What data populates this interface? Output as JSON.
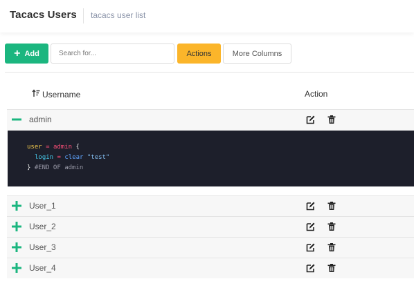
{
  "header": {
    "title": "Tacacs Users",
    "subtitle": "tacacs user list"
  },
  "toolbar": {
    "add_label": "Add",
    "search_placeholder": "Search for...",
    "actions_label": "Actions",
    "more_columns_label": "More Columns"
  },
  "table": {
    "columns": [
      "Username",
      "Action"
    ],
    "rows": [
      {
        "username": "admin",
        "expanded": true
      },
      {
        "username": "User_1",
        "expanded": false
      },
      {
        "username": "User_2",
        "expanded": false
      },
      {
        "username": "User_3",
        "expanded": false
      },
      {
        "username": "User_4",
        "expanded": false
      }
    ]
  },
  "code_block": {
    "line1": [
      "user",
      "=",
      "admin",
      "{"
    ],
    "line2": [
      "login",
      "=",
      "clear",
      "\"test\""
    ],
    "line3": [
      "}",
      "#END OF admin"
    ]
  },
  "colors": {
    "add_button": "#1bb67f",
    "actions_button": "#fbb52a",
    "toggle_icon": "#1bb67f",
    "code_background": "#1d1f2b"
  },
  "icons": {
    "expand": "plus-icon",
    "collapse": "minus-icon",
    "edit": "edit-icon",
    "delete": "trash-icon",
    "sort": "sort-icon"
  }
}
